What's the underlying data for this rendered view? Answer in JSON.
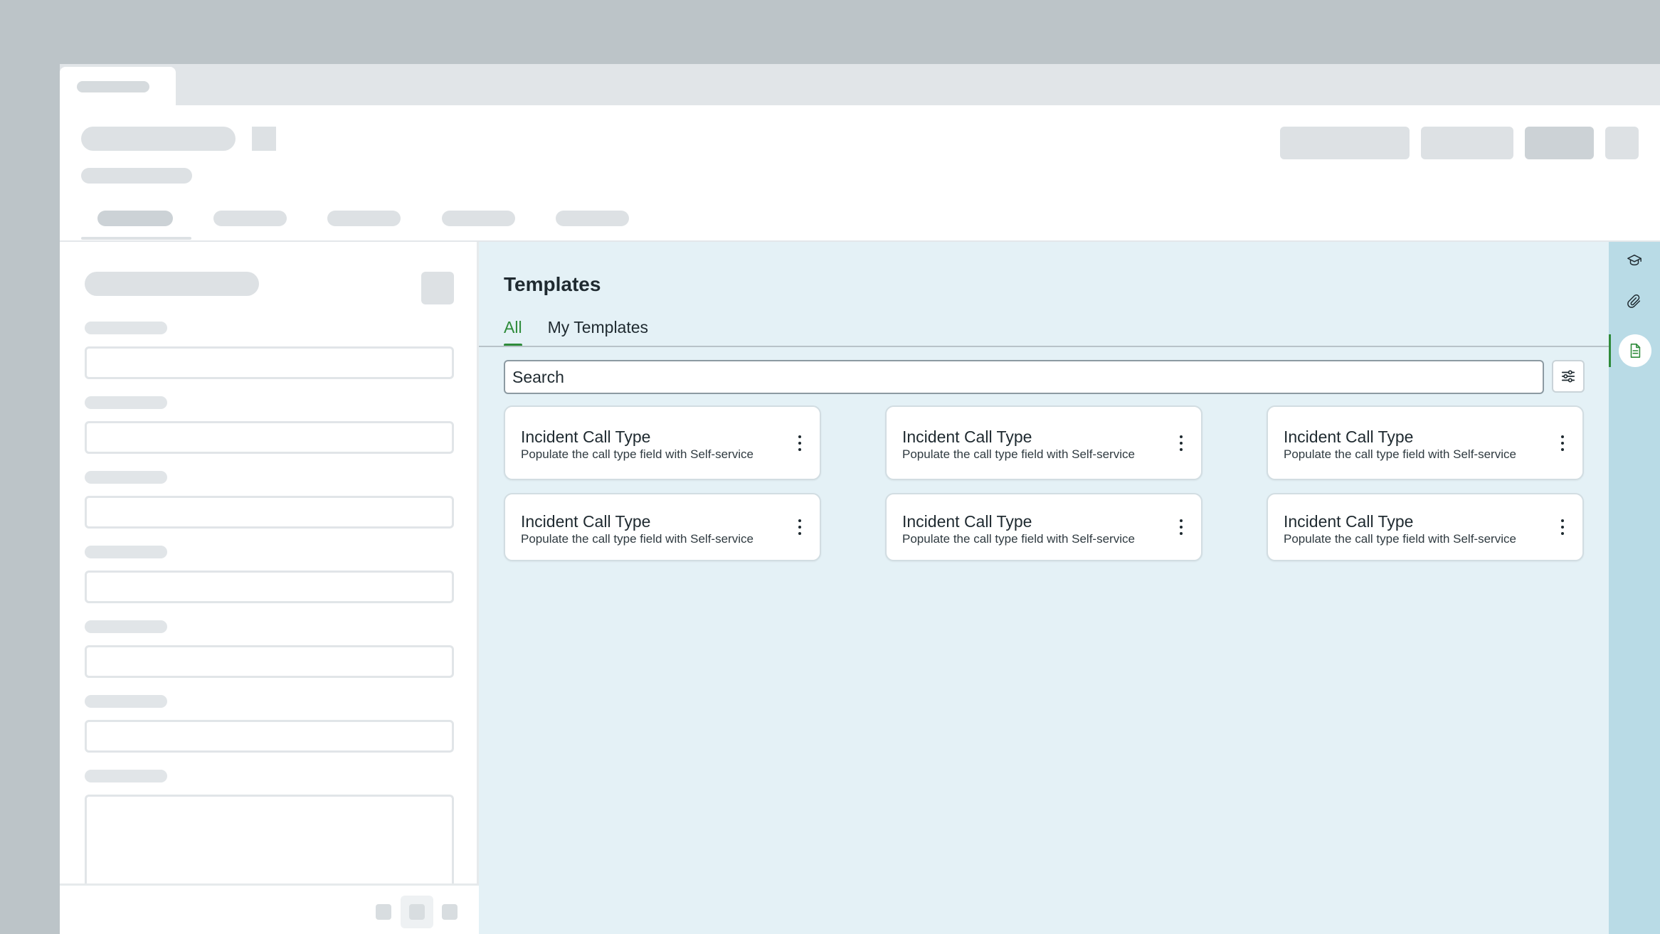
{
  "templates": {
    "title": "Templates",
    "tabs": [
      {
        "label": "All",
        "active": true
      },
      {
        "label": "My Templates",
        "active": false
      }
    ],
    "search": {
      "placeholder": "Search",
      "value": ""
    },
    "cards": [
      {
        "title": "Incident Call Type",
        "description": "Populate the call type field with Self-service"
      },
      {
        "title": "Incident Call Type",
        "description": "Populate the call type field with Self-service"
      },
      {
        "title": "Incident Call Type",
        "description": "Populate the call type field with Self-service"
      },
      {
        "title": "Incident Call Type",
        "description": "Populate the call type field with Self-service"
      },
      {
        "title": "Incident Call Type",
        "description": "Populate the call type field with Self-service"
      },
      {
        "title": "Incident Call Type",
        "description": "Populate the call type field with Self-service"
      }
    ]
  },
  "rail": {
    "icons": [
      "graduation-cap-icon",
      "paperclip-icon",
      "document-icon"
    ],
    "active_icon": "document-icon"
  },
  "colors": {
    "accent": "#2e8b3a",
    "panel_bg": "#e4f1f6",
    "rail_bg": "#b9dbe6",
    "text": "#1f2a30"
  }
}
